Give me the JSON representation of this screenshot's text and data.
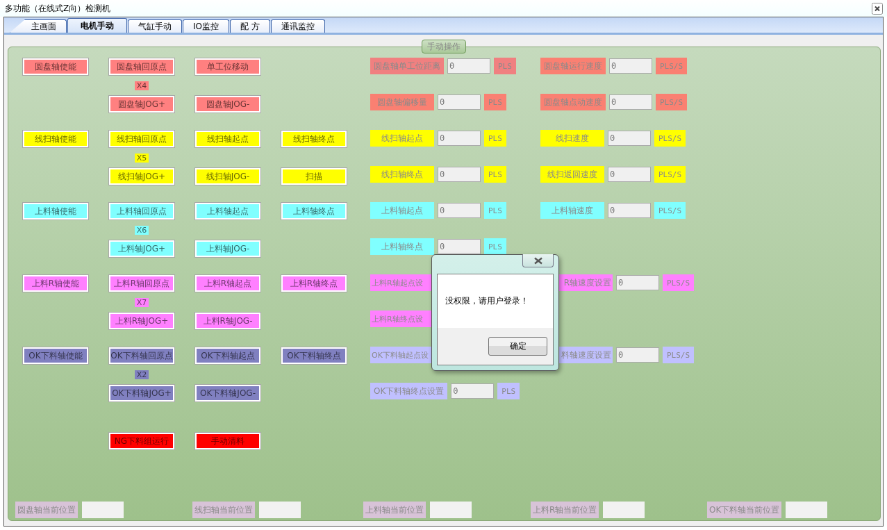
{
  "window": {
    "title": "多功能（在线式Z向）检测机"
  },
  "tabs": [
    {
      "label": "主画面",
      "selected": false
    },
    {
      "label": "电机手动",
      "selected": true
    },
    {
      "label": "气缸手动",
      "selected": false
    },
    {
      "label": "IO监控",
      "selected": false
    },
    {
      "label": "配 方",
      "selected": false
    },
    {
      "label": "通讯监控",
      "selected": false
    }
  ],
  "group_box": {
    "title": "手动操作"
  },
  "button_groups": [
    {
      "color": "#ff8080",
      "row1": [
        "圆盘轴使能",
        "圆盘轴回原点",
        "单工位移动"
      ],
      "tag": "X4",
      "row2": [
        "圆盘轴JOG+",
        "圆盘轴JOG-"
      ]
    },
    {
      "color": "#ffff00",
      "row1": [
        "线扫轴使能",
        "线扫轴回原点",
        "线扫轴起点",
        "线扫轴终点"
      ],
      "tag": "X5",
      "row2": [
        "线扫轴JOG+",
        "线扫轴JOG-",
        "扫描"
      ]
    },
    {
      "color": "#80ffff",
      "row1": [
        "上料轴使能",
        "上料轴回原点",
        "上料轴起点",
        "上料轴终点"
      ],
      "tag": "X6",
      "row2": [
        "上料轴JOG+",
        "上料轴JOG-"
      ]
    },
    {
      "color": "#ff80ff",
      "row1": [
        "上料R轴使能",
        "上料R轴回原点",
        "上料R轴起点",
        "上料R轴终点"
      ],
      "tag": "X7",
      "row2": [
        "上料R轴JOG+",
        "上料R轴JOG-"
      ]
    },
    {
      "color": "#8080c0",
      "row1": [
        "OK下料轴使能",
        "OK下料轴回原点",
        "OK下料轴起点",
        "OK下料轴终点"
      ],
      "tag": "X2",
      "row2": [
        "OK下料轴JOG+",
        "OK下料轴JOG-"
      ]
    }
  ],
  "run_buttons": {
    "color": "#ff0000",
    "labels": [
      "NG下料组运行",
      "手动清料"
    ]
  },
  "field_rows": [
    {
      "left": {
        "label": "圆盘轴单工位距离",
        "value": "0",
        "unit": "PLS",
        "color": "#f08080"
      },
      "right": {
        "label": "圆盘轴运行速度",
        "value": "0",
        "unit": "PLS/S",
        "color": "#fa8072"
      }
    },
    {
      "left": {
        "label": "圆盘轴偏移量",
        "value": "0",
        "unit": "PLS",
        "color": "#fa8072"
      },
      "right": {
        "label": "圆盘轴点动速度",
        "value": "0",
        "unit": "PLS/S",
        "color": "#fa8072"
      }
    },
    {
      "left": {
        "label": "线扫轴起点",
        "value": "0",
        "unit": "PLS",
        "color": "#ffff00"
      },
      "right": {
        "label": "线扫速度",
        "value": "0",
        "unit": "PLS/S",
        "color": "#ffff00"
      }
    },
    {
      "left": {
        "label": "线扫轴终点",
        "value": "0",
        "unit": "PLS",
        "color": "#ffff00"
      },
      "right": {
        "label": "线扫返回速度",
        "value": "0",
        "unit": "PLS/S",
        "color": "#ffff00"
      }
    },
    {
      "left": {
        "label": "上料轴起点",
        "value": "0",
        "unit": "PLS",
        "color": "#80ffff"
      },
      "right": {
        "label": "上料轴速度",
        "value": "0",
        "unit": "PLS/S",
        "color": "#80ffff"
      }
    },
    {
      "left": {
        "label": "上料轴终点",
        "value": "0",
        "unit": "PLS",
        "color": "#80ffff"
      }
    },
    {
      "left": {
        "label": "上料R轴起点设",
        "color": "#ff80ff"
      },
      "right": {
        "label": "R轴速度设置",
        "value": "0",
        "unit": "PLS/S",
        "color": "#ff80ff"
      }
    },
    {
      "left": {
        "label": "上料R轴终点设",
        "color": "#ff80ff"
      }
    },
    {
      "left": {
        "label": "OK下料轴起点设",
        "color": "#c0c0ff"
      },
      "right": {
        "label": "料轴速度设置",
        "value": "0",
        "unit": "PLS/S",
        "color": "#c0c0ff"
      }
    },
    {
      "left": {
        "label": "OK下料轴终点设置",
        "value": "0",
        "unit": "PLS",
        "color": "#c0c0ff"
      }
    }
  ],
  "positions": [
    {
      "label": "圆盘轴当前位置"
    },
    {
      "label": "线扫轴当前位置"
    },
    {
      "label": "上料轴当前位置"
    },
    {
      "label": "上料R轴当前位置"
    },
    {
      "label": "OK下料轴当前位置"
    }
  ],
  "dialog": {
    "message": "没权限，请用户登录！",
    "ok": "确定"
  }
}
